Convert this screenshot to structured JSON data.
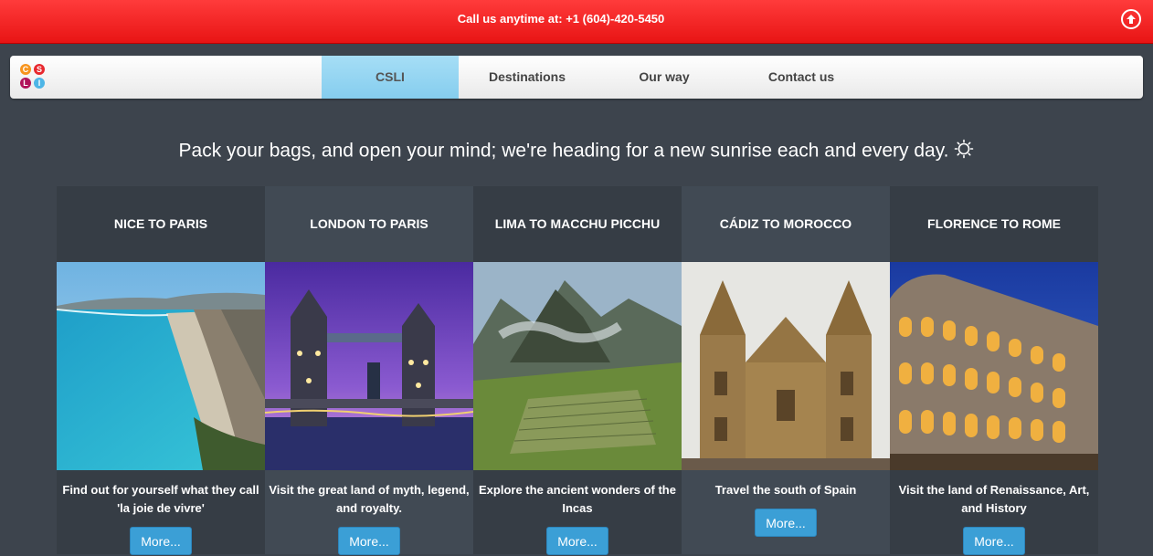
{
  "topbar": {
    "phone_text": "Call us anytime at: +1 (604)-420-5450"
  },
  "logo": {
    "letters": [
      "C",
      "S",
      "L",
      "I"
    ]
  },
  "nav": {
    "tabs": [
      "CSLI",
      "Destinations",
      "Our way",
      "Contact us"
    ],
    "active": "CSLI"
  },
  "tagline": "Pack your bags, and open your mind; we're heading for a new sunrise each and every day.",
  "tours": [
    {
      "title": "NICE TO PARIS",
      "desc": "Find out for yourself what they call 'la joie de vivre'",
      "button": "More..."
    },
    {
      "title": "LONDON TO PARIS",
      "desc": "Visit the great land of myth, legend, and royalty.",
      "button": "More..."
    },
    {
      "title": "LIMA TO MACCHU PICCHU",
      "desc": "Explore the ancient wonders of the Incas",
      "button": "More..."
    },
    {
      "title": "CÁDIZ TO MOROCCO",
      "desc": "Travel the south of Spain",
      "button": "More..."
    },
    {
      "title": "FLORENCE TO ROME",
      "desc": "Visit the land of Renaissance, Art, and History",
      "button": "More..."
    }
  ],
  "colors": {
    "topbar": "#f02020",
    "accent": "#3b9fd6",
    "active_tab": "#98d6f2"
  },
  "icons": [
    "arrow-up-circle-icon",
    "sun-icon"
  ]
}
